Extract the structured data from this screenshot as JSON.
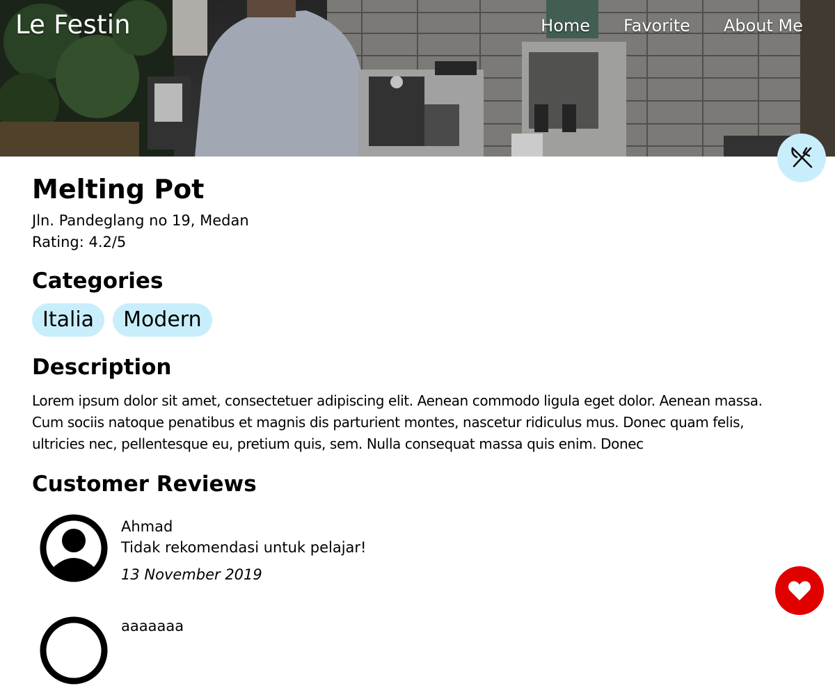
{
  "header": {
    "brand": "Le Festin",
    "nav": [
      "Home",
      "Favorite",
      "About Me"
    ]
  },
  "hero_icon": "fork-knife-icon",
  "restaurant": {
    "name": "Melting Pot",
    "address": "Jln. Pandeglang no 19, Medan",
    "rating": "Rating: 4.2/5"
  },
  "categories": {
    "title": "Categories",
    "items": [
      "Italia",
      "Modern"
    ]
  },
  "description": {
    "title": "Description",
    "text": "Lorem ipsum dolor sit amet, consectetuer adipiscing elit. Aenean commodo ligula eget dolor. Aenean massa. Cum sociis natoque penatibus et magnis dis parturient montes, nascetur ridiculus mus. Donec quam felis, ultricies nec, pellentesque eu, pretium quis, sem. Nulla consequat massa quis enim. Donec"
  },
  "reviews": {
    "title": "Customer Reviews",
    "items": [
      {
        "name": "Ahmad",
        "review": "Tidak rekomendasi untuk pelajar!",
        "date": "13 November 2019"
      }
    ],
    "partial_next_name": "aaaaaaa"
  },
  "favorite_icon": "heart-icon",
  "colors": {
    "chip_bg": "#c9eefb",
    "favorite_bg": "#e00000",
    "text": "#000000",
    "header_text": "#ffffff"
  }
}
